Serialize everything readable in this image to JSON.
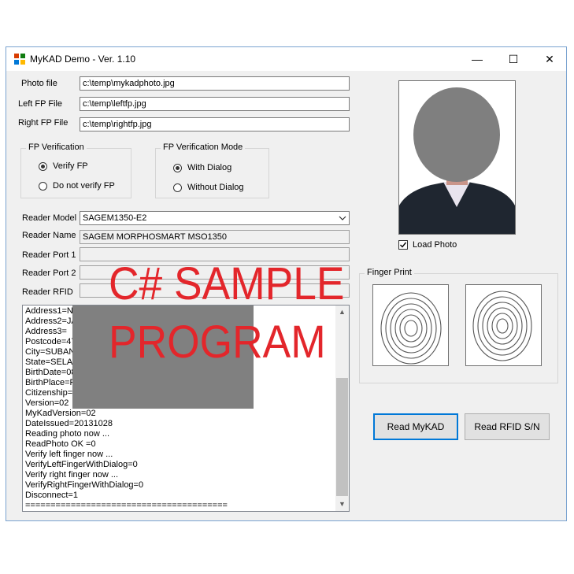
{
  "window": {
    "title": "MyKAD Demo - Ver. 1.10",
    "minimize": "—",
    "maximize": "☐",
    "close": "✕"
  },
  "files": {
    "photo_label": "Photo file",
    "photo_value": "c:\\temp\\mykadphoto.jpg",
    "left_label": "Left FP File",
    "left_value": "c:\\temp\\leftfp.jpg",
    "right_label": "Right FP File",
    "right_value": "c:\\temp\\rightfp.jpg"
  },
  "fp_verification": {
    "title": "FP Verification",
    "options": [
      "Verify FP",
      "Do not verify FP"
    ],
    "selected": "Verify FP"
  },
  "fp_mode": {
    "title": "FP Verification Mode",
    "options": [
      "With Dialog",
      "Without Dialog"
    ],
    "selected": "With Dialog"
  },
  "reader": {
    "model_label": "Reader Model",
    "model_value": "SAGEM1350-E2",
    "name_label": "Reader Name",
    "name_value": "SAGEM MORPHOSMART MSO1350",
    "port1_label": "Reader Port 1",
    "port1_value": "",
    "port2_label": "Reader Port 2",
    "port2_value": "",
    "rfid_label": "Reader RFID",
    "rfid_value": ""
  },
  "log_lines": [
    "Address1=NO",
    "Address2=JA",
    "Address3=",
    "Postcode=47",
    "City=SUBAN",
    "State=SELAN",
    "BirthDate=08",
    "BirthPlace=P",
    "Citizenship=W",
    "Version=02",
    "MyKadVersion=02",
    "DateIssued=20131028",
    "Reading photo now ...",
    "ReadPhoto OK =0",
    "Verify left finger now ...",
    "VerifyLeftFingerWithDialog=0",
    "Verify right finger now ...",
    "VerifyRightFingerWithDialog=0",
    "Disconnect=1",
    "========================================"
  ],
  "photo": {
    "load_label": "Load Photo",
    "load_checked": true
  },
  "fingerprint": {
    "title": "Finger Print"
  },
  "buttons": {
    "read_mykad": "Read MyKAD",
    "read_rfid": "Read RFID S/N"
  },
  "watermark": {
    "line1": "C# SAMPLE",
    "line2": "PROGRAM",
    "color": "#e3262b"
  }
}
